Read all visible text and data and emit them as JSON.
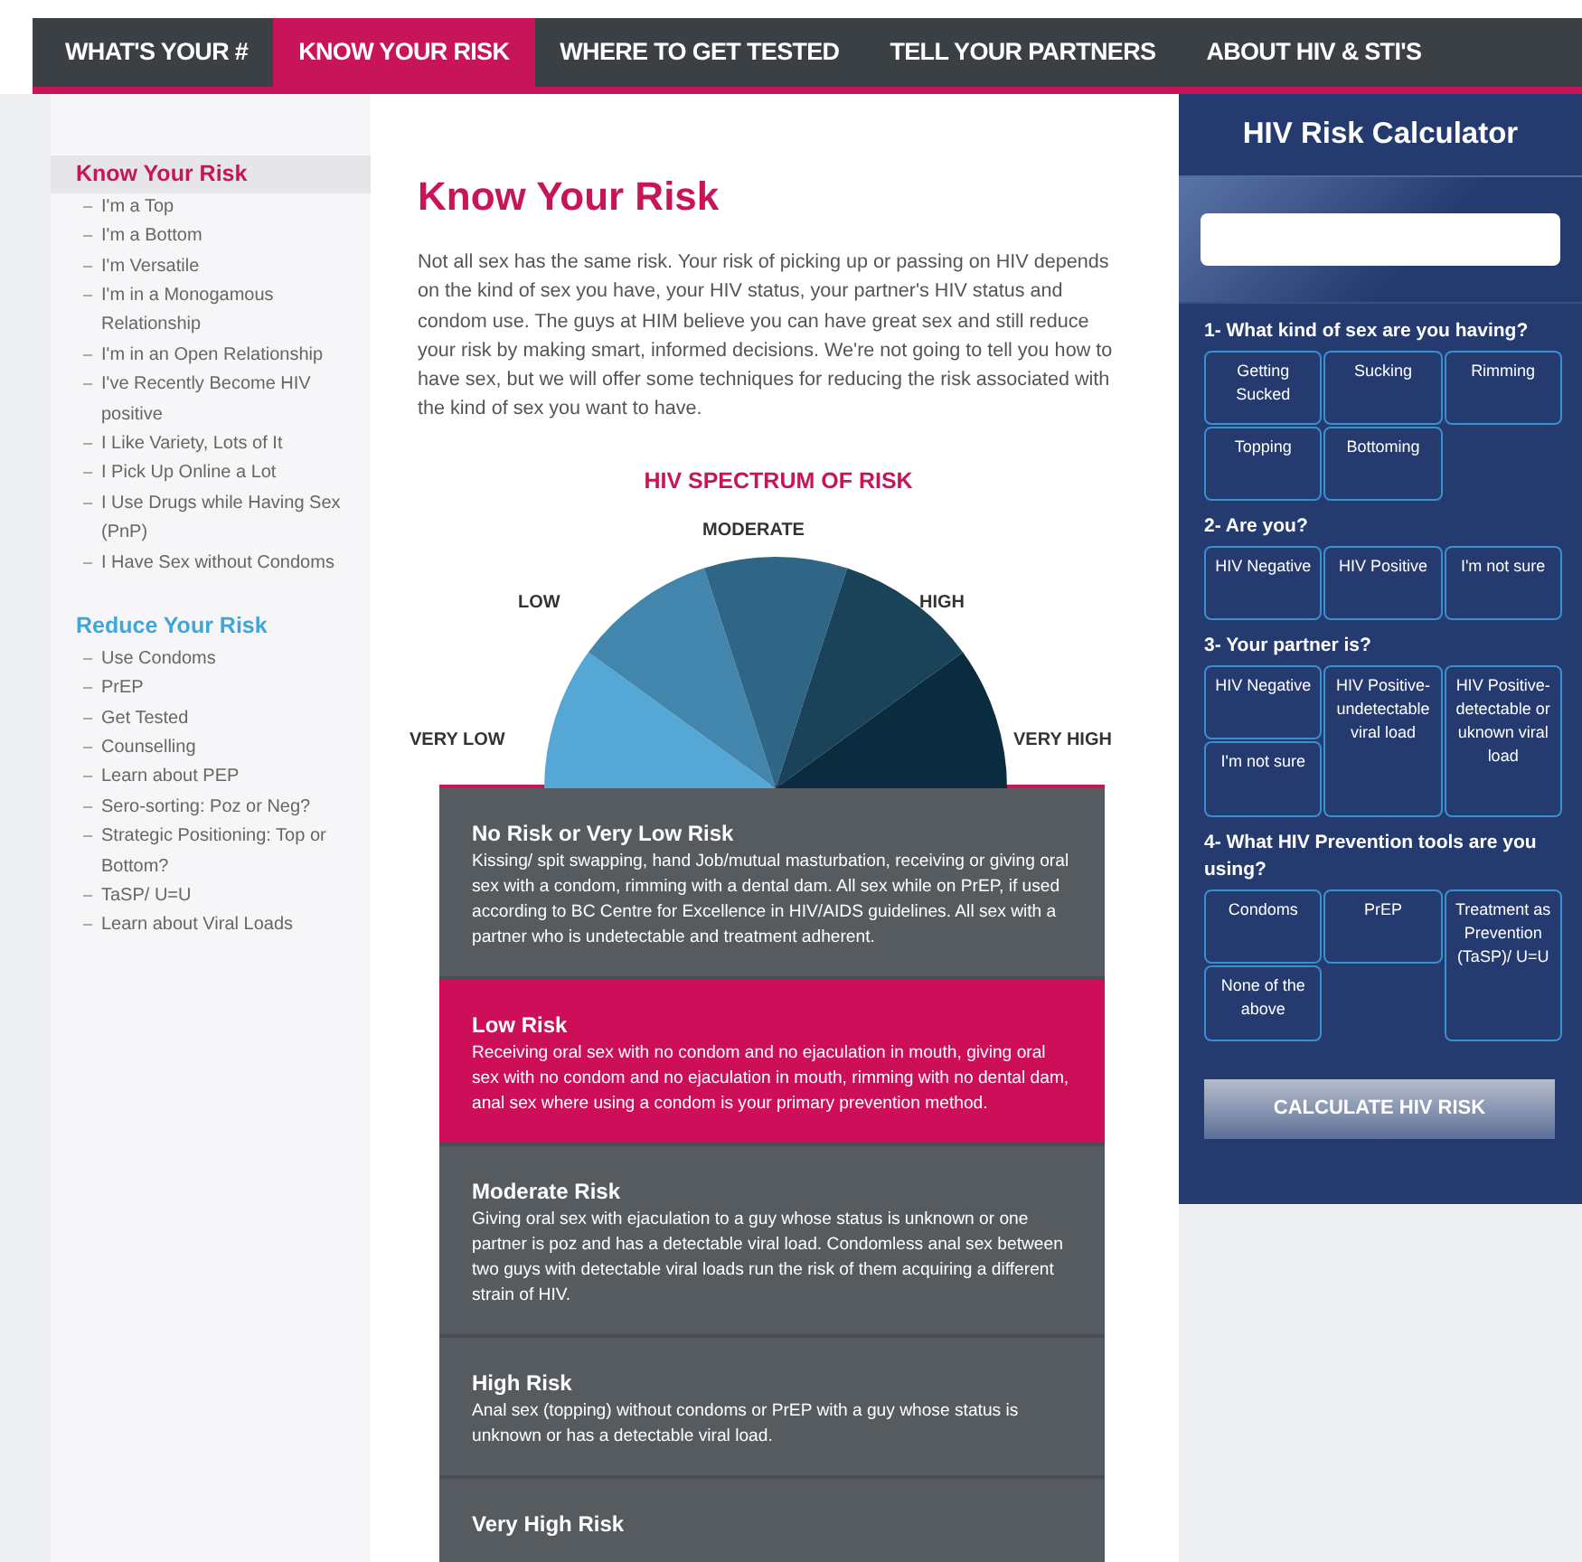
{
  "nav": {
    "tabs": [
      {
        "label": "WHAT'S YOUR #",
        "selected": false
      },
      {
        "label": "KNOW YOUR RISK",
        "selected": true
      },
      {
        "label": "WHERE TO GET TESTED",
        "selected": false
      },
      {
        "label": "TELL YOUR PARTNERS",
        "selected": false
      },
      {
        "label": "ABOUT HIV & STI'S",
        "selected": false
      }
    ]
  },
  "sidebar": {
    "sections": [
      {
        "heading": "Know Your Risk",
        "selected": true,
        "color": "#c8155a",
        "children": [
          {
            "label": "I'm a Top"
          },
          {
            "label": "I'm a Bottom"
          },
          {
            "label": "I'm Versatile"
          },
          {
            "label": "I'm in a Monogamous Relationship"
          },
          {
            "label": "I'm in an Open Relationship"
          },
          {
            "label": "I've Recently Become HIV positive"
          },
          {
            "label": "I Like Variety, Lots of It"
          },
          {
            "label": "I Pick Up Online a Lot"
          },
          {
            "label": "I Use Drugs while Having Sex (PnP)"
          },
          {
            "label": "I Have Sex without Condoms"
          }
        ]
      },
      {
        "heading": "Reduce Your Risk",
        "selected": false,
        "color": "#3fa6dc",
        "children": [
          {
            "label": "Use Condoms"
          },
          {
            "label": "PrEP"
          },
          {
            "label": "Get Tested"
          },
          {
            "label": "Counselling"
          },
          {
            "label": "Learn about PEP"
          },
          {
            "label": "Sero-sorting: Poz or Neg?"
          },
          {
            "label": "Strategic Positioning: Top or Bottom?"
          },
          {
            "label": "TaSP/ U=U"
          },
          {
            "label": "Learn about Viral Loads"
          }
        ]
      }
    ]
  },
  "main": {
    "title": "Know Your Risk",
    "intro": "Not all sex has the same risk. Your risk of picking up or passing on HIV depends on the kind of sex you have, your HIV status, your partner's HIV status and condom use.  The guys at HIM believe you can have great sex and still reduce your risk by making smart, informed decisions. We're not going to tell you how to have sex, but we will offer some techniques for reducing the risk associated with the kind of sex you want to have.",
    "spectrum": {
      "title": "HIV SPECTRUM OF RISK",
      "labels": [
        "VERY LOW",
        "LOW",
        "MODERATE",
        "HIGH",
        "VERY HIGH"
      ]
    },
    "risks": [
      {
        "title": "No Risk or Very Low Risk",
        "text": "Kissing/ spit swapping, hand Job/mutual masturbation, receiving or giving oral sex with a condom, rimming with a dental dam. All sex while on PrEP, if used according to BC Centre for Excellence in HIV/AIDS guidelines. All sex with a partner who is undetectable and treatment adherent.",
        "selected": false
      },
      {
        "title": "Low Risk",
        "text": "Receiving oral sex with no condom and no ejaculation in mouth, giving oral sex with no condom and no ejaculation in mouth, rimming with no dental dam, anal sex where using a condom is your primary prevention method.",
        "selected": true
      },
      {
        "title": "Moderate Risk",
        "text": "Giving oral sex with ejaculation to a guy whose status is unknown or one partner is poz and has a detectable viral load. Condomless anal sex between two guys with detectable viral loads run the risk of them acquiring a different strain of HIV.",
        "selected": false
      },
      {
        "title": "High Risk",
        "text": "Anal sex (topping) without condoms or PrEP with a guy whose status is unknown or has a detectable viral load.",
        "selected": false
      },
      {
        "title": "Very High Risk",
        "selected": false
      }
    ]
  },
  "calculator": {
    "title": "HIV Risk Calculator",
    "questions": [
      {
        "label": "1- What kind of sex are you having?",
        "options": [
          {
            "label": "Getting Sucked",
            "kind": "short"
          },
          {
            "label": "Sucking",
            "kind": "short"
          },
          {
            "label": "Rimming",
            "kind": "short"
          },
          {
            "label": "Topping",
            "kind": "short"
          },
          {
            "label": "Bottoming",
            "kind": "short"
          }
        ]
      },
      {
        "label": "2- Are you?",
        "options": [
          {
            "label": "HIV Negative",
            "kind": "short"
          },
          {
            "label": "HIV Positive",
            "kind": "short"
          },
          {
            "label": "I'm not sure",
            "kind": "short"
          }
        ]
      },
      {
        "label": "3- Your partner is?",
        "options": [
          {
            "label": "HIV Negative",
            "kind": "short"
          },
          {
            "label": "HIV Positive-undetectable viral load",
            "kind": "tall"
          },
          {
            "label": "HIV Positive-detectable or uknown viral load",
            "kind": "tall"
          },
          {
            "label": "I'm not sure",
            "kind": "short"
          }
        ]
      },
      {
        "label": "4- What HIV Prevention tools are you using?",
        "options": [
          {
            "label": "Condoms",
            "kind": "short"
          },
          {
            "label": "PrEP",
            "kind": "short"
          },
          {
            "label": "Treatment as Prevention (TaSP)/ U=U",
            "kind": "tall"
          },
          {
            "label": "None of the above",
            "kind": "short"
          }
        ]
      }
    ],
    "button": "CALCULATE HIV RISK"
  }
}
